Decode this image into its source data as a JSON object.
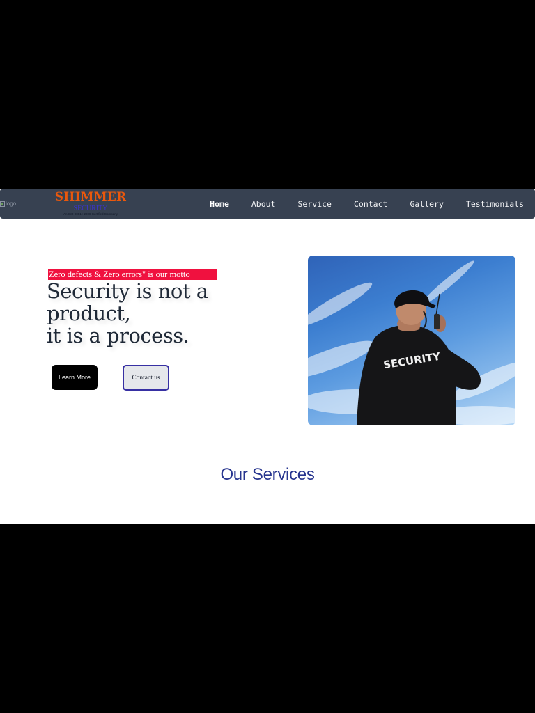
{
  "nav": {
    "logo_alt": "logo",
    "brand_name": "SHIMMER",
    "brand_sub": "SECURITY",
    "brand_tag": "An ISO 9001 : 2008 Certified Company",
    "links": [
      {
        "label": "Home",
        "active": true
      },
      {
        "label": "About"
      },
      {
        "label": "Service"
      },
      {
        "label": "Contact"
      },
      {
        "label": "Gallery"
      },
      {
        "label": "Testimonials"
      }
    ]
  },
  "hero": {
    "motto": "Zero defects & Zero errors\" is our motto",
    "headline": [
      "Security is not a",
      "product,",
      "it is a process."
    ],
    "learn_more": "Learn More",
    "contact_us": "Contact us",
    "image_text": "SECURITY"
  },
  "services": {
    "title": "Our Services"
  },
  "colors": {
    "navbar": "#374151",
    "brand": "#ea580c",
    "brand_sub": "#3b34c9",
    "motto_bg": "#f0113f",
    "section_title": "#27358f"
  }
}
